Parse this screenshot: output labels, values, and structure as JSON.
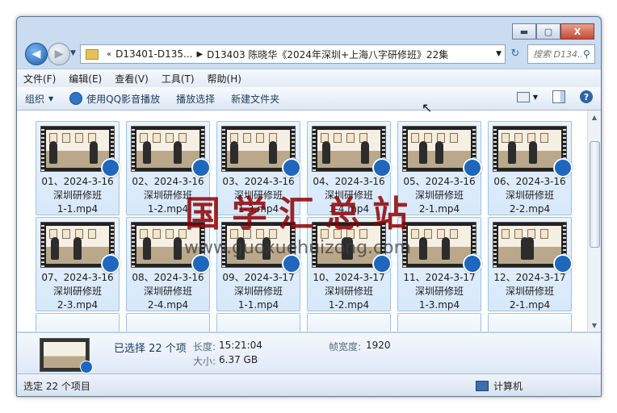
{
  "window": {
    "minimize": "▬",
    "maximize": "▢",
    "close": "X"
  },
  "nav": {
    "back": "◀",
    "forward": "▶",
    "history": "▼"
  },
  "breadcrumb": {
    "prefix": "«",
    "items": [
      "D13401-D135...",
      "D13403 陈晓华《2024年深圳+上海八字研修班》22集"
    ],
    "separator": "▶",
    "dropdown": "▼"
  },
  "refresh": "↻",
  "search": {
    "placeholder": "搜索 D134...",
    "icon": "⚲"
  },
  "menu": [
    "文件(F)",
    "编辑(E)",
    "查看(V)",
    "工具(T)",
    "帮助(H)"
  ],
  "toolbar": {
    "organize": "组织",
    "organize_caret": "▼",
    "play_qq": "使用QQ影音播放",
    "play_selection": "播放选择",
    "new_folder": "新建文件夹",
    "view_caret": "▼",
    "help": "?"
  },
  "files": [
    {
      "name": [
        "01、2024-3-16",
        "深圳研修班",
        "1-1.mp4"
      ]
    },
    {
      "name": [
        "02、2024-3-16",
        "深圳研修班",
        "1-2.mp4"
      ]
    },
    {
      "name": [
        "03、2024-3-16",
        "深圳研修班",
        "1-3.mp4"
      ]
    },
    {
      "name": [
        "04、2024-3-16",
        "深圳研修班",
        "1-4.mp4"
      ]
    },
    {
      "name": [
        "05、2024-3-16",
        "深圳研修班",
        "2-1.mp4"
      ]
    },
    {
      "name": [
        "06、2024-3-16",
        "深圳研修班",
        "2-2.mp4"
      ]
    },
    {
      "name": [
        "07、2024-3-16",
        "深圳研修班",
        "2-3.mp4"
      ]
    },
    {
      "name": [
        "08、2024-3-16",
        "深圳研修班",
        "2-4.mp4"
      ]
    },
    {
      "name": [
        "09、2024-3-17",
        "深圳研修班",
        "1-1.mp4"
      ]
    },
    {
      "name": [
        "10、2024-3-17",
        "深圳研修班",
        "1-2.mp4"
      ]
    },
    {
      "name": [
        "11、2024-3-17",
        "深圳研修班",
        "1-3.mp4"
      ]
    },
    {
      "name": [
        "12、2024-3-17",
        "深圳研修班",
        "2-1.mp4"
      ]
    }
  ],
  "scroll": {
    "up": "▲",
    "down": "▼"
  },
  "watermark": {
    "text": "国学汇总站",
    "url": "www.guoxuehuizong.com"
  },
  "details": {
    "selected": "已选择 22 个项",
    "length_label": "长度:",
    "length_value": "15:21:04",
    "size_label": "大小:",
    "size_value": "6.37 GB",
    "width_label": "帧宽度:",
    "width_value": "1920"
  },
  "status": {
    "left": "选定 22 个项目",
    "right": "计算机"
  }
}
